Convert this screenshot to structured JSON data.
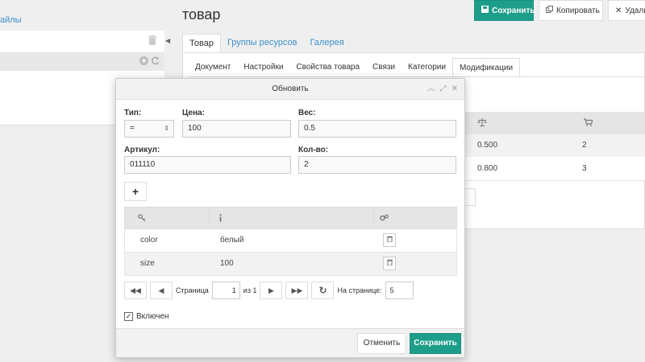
{
  "left": {
    "files_link": "айлы"
  },
  "header": {
    "title": "товар",
    "save": "Сохранить",
    "copy": "Копировать",
    "delete": "Удалит"
  },
  "main_tabs": [
    "Товар",
    "Группы ресурсов",
    "Галерея"
  ],
  "sub_tabs": [
    "Документ",
    "Настройки",
    "Свойства товара",
    "Связи",
    "Категории",
    "Модификации"
  ],
  "bg_table": {
    "rows": [
      {
        "weight": "0.500",
        "count": "2"
      },
      {
        "weight": "0.800",
        "count": "3"
      }
    ]
  },
  "modal": {
    "title": "Обновить",
    "labels": {
      "type": "Тип:",
      "price": "Цена:",
      "weight": "Вес:",
      "article": "Артикул:",
      "qty": "Кол-во:"
    },
    "values": {
      "type": "=",
      "price": "100",
      "weight": "0.5",
      "article": "011110",
      "qty": "2"
    },
    "table": {
      "rows": [
        {
          "key": "color",
          "value": "белый"
        },
        {
          "key": "size",
          "value": "100"
        }
      ]
    },
    "pager": {
      "page_label": "Страница",
      "page": "1",
      "of": "из 1",
      "per_page_label": "На странице:",
      "per_page": "5"
    },
    "enabled_label": "Включен",
    "cancel": "Отменить",
    "save": "Сохранить"
  },
  "colors": {
    "accent": "#1d9e8a",
    "link": "#3d8fc9"
  }
}
